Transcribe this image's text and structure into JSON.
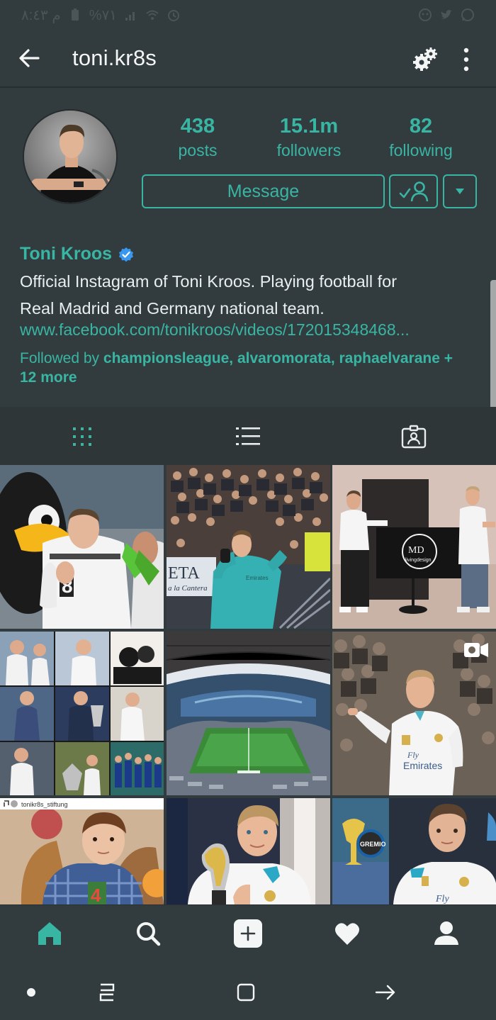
{
  "status_bar": {
    "time": "م ٨:٤٣",
    "battery": "%٧١",
    "icons": [
      "battery-icon",
      "signal-icon",
      "wifi-icon",
      "alarm-icon",
      "app-notification-icon",
      "twitter-icon",
      "whatsapp-icon"
    ]
  },
  "header": {
    "username": "toni.kr8s",
    "icons": [
      "back-arrow-icon",
      "settings-gear-icon",
      "more-vert-icon"
    ]
  },
  "profile": {
    "stats": [
      {
        "value": "438",
        "label": "posts"
      },
      {
        "value": "15.1m",
        "label": "followers"
      },
      {
        "value": "82",
        "label": "following"
      }
    ],
    "message_label": "Message",
    "display_name": "Toni Kroos",
    "verified": true,
    "bio_line1": "Official Instagram of Toni Kroos. Playing football for",
    "bio_line2": "Real Madrid and Germany national team.",
    "website": "www.facebook.com/tonikroos/videos/172015348468...",
    "followed_by_prefix": "Followed by ",
    "followed_by_names": "championsleague, alvaromorata, raphaelvarane",
    "followed_by_suffix": " + 12 more"
  },
  "tabs": [
    "grid-icon",
    "list-icon",
    "tagged-icon"
  ],
  "grid": {
    "repost_caption": "tonikr8s_stiftung",
    "tiles": [
      {
        "name": "post-germany-jersey",
        "description": "Player in white Germany kit with mascot"
      },
      {
        "name": "post-training-stands",
        "description": "Player in teal goalkeeper top in front of stands"
      },
      {
        "name": "post-md-livingdesign",
        "description": "Two men beside MD livingdesign screen"
      },
      {
        "name": "post-collage",
        "description": "Collage of trophy photos"
      },
      {
        "name": "post-stadium",
        "description": "Stadium panorama"
      },
      {
        "name": "post-video-celebration",
        "description": "Player in Real Madrid kit pointing"
      },
      {
        "name": "post-child-repost",
        "description": "Child holding number 4 birthday candle"
      },
      {
        "name": "post-trophy",
        "description": "Player holding Club World Cup trophy"
      },
      {
        "name": "post-gremio",
        "description": "Player in Real Madrid kit with Gremio logo"
      }
    ],
    "md_logo_text": "MD",
    "md_logo_sub": "livingdesign",
    "eta_text": "ETA",
    "eta_sub": "a la Cantera",
    "gremio_text": "GREMIO",
    "fly_text": "Fly",
    "emirates_text": "Emirates",
    "jersey_number": "8",
    "candle_number": "4"
  },
  "bottom_nav": [
    "home-icon",
    "search-icon",
    "new-post-icon",
    "activity-heart-icon",
    "profile-icon"
  ],
  "system_nav": [
    "dot-icon",
    "recent-apps-icon",
    "home-square-icon",
    "back-icon"
  ],
  "colors": {
    "background": "#323b3d",
    "accent": "#39b5a4",
    "text": "#e9eeef",
    "verified": "#3897f0"
  }
}
